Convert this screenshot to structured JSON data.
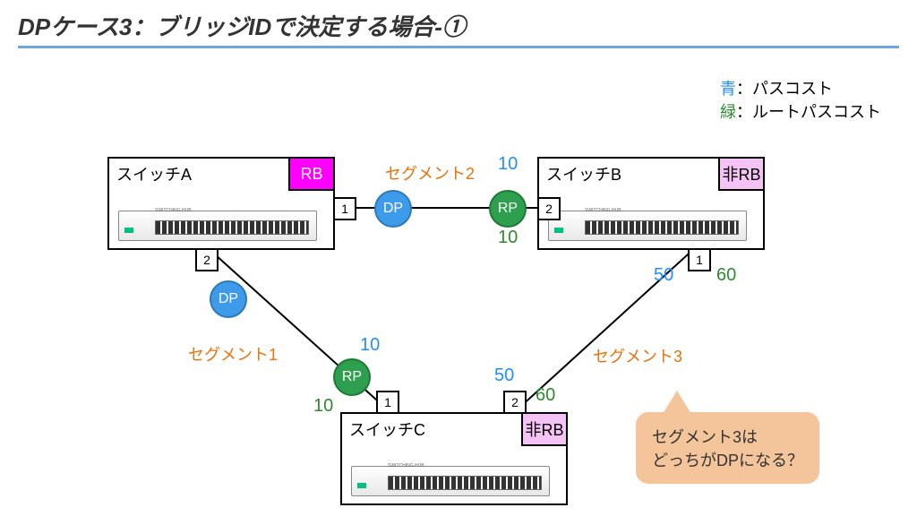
{
  "title": "DPケース3：ブリッジIDで決定する場合-①",
  "legend": {
    "blue_label": "青",
    "blue_desc": "：パスコスト",
    "green_label": "緑",
    "green_desc": "：ルートパスコスト"
  },
  "switches": {
    "A": {
      "name": "スイッチA",
      "role": "RB"
    },
    "B": {
      "name": "スイッチB",
      "role": "非RB"
    },
    "C": {
      "name": "スイッチC",
      "role": "非RB"
    }
  },
  "segments": {
    "s1": "セグメント1",
    "s2": "セグメント2",
    "s3": "セグメント3"
  },
  "roles": {
    "dp": "DP",
    "rp": "RP"
  },
  "ports": {
    "A_p1": "1",
    "A_p2": "2",
    "B_p2": "2",
    "B_p1": "1",
    "C_p1": "1",
    "C_p2": "2"
  },
  "costs": {
    "seg2_path": "10",
    "B_rootpath": "10",
    "seg1_path": "10",
    "C_rootpath_left": "10",
    "B_p1_path": "50",
    "B_p1_root": "60",
    "C_p2_path": "50",
    "C_p2_root": "60"
  },
  "callout": {
    "line1": "セグメント3は",
    "line2": "どっちがDPになる？"
  },
  "hub_text": "SWITCHING HUB"
}
